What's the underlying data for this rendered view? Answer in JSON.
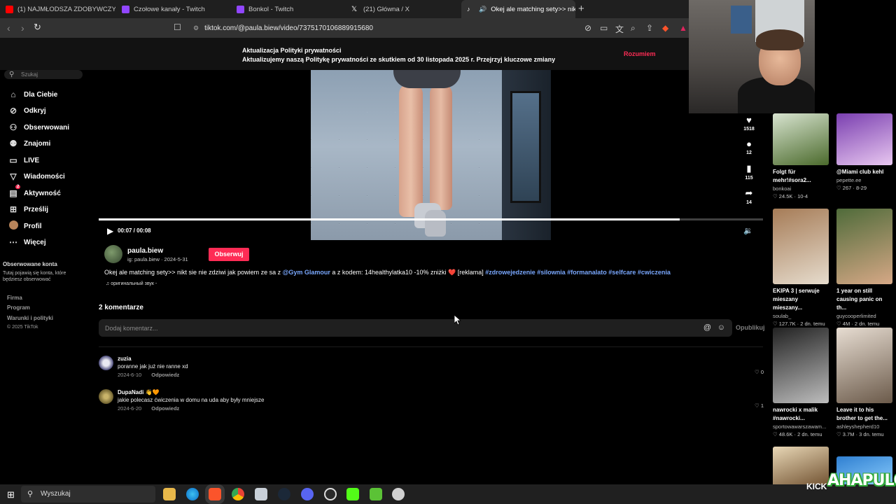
{
  "browser": {
    "tabs": [
      {
        "label": "(1) NAJMŁODSZA ZDOBYWCZYNI M",
        "favicon_color": "#ff0000"
      },
      {
        "label": "Czołowe kanały - Twitch",
        "favicon_color": "#9146ff"
      },
      {
        "label": "Bonkol - Twitch",
        "favicon_color": "#9146ff"
      },
      {
        "label": "(21) Główna / X",
        "favicon_color": "#ffffff"
      },
      {
        "label": "Okej ale matching sety>> nik",
        "favicon_color": "#ffffff"
      }
    ],
    "url": "tiktok.com/@paula.biew/video/7375170106889915680"
  },
  "banner": {
    "title": "Aktualizacja Polityki prywatności",
    "text": "Aktualizujemy naszą Politykę prywatności ze skutkiem od 30 listopada 2025 r. Przejrzyj kluczowe zmiany",
    "button": "Rozumiem"
  },
  "sidebar": {
    "search_placeholder": "Szukaj",
    "items": [
      {
        "label": "Dla Ciebie",
        "icon": "home-icon"
      },
      {
        "label": "Odkryj",
        "icon": "compass-icon"
      },
      {
        "label": "Obserwowani",
        "icon": "following-icon"
      },
      {
        "label": "Znajomi",
        "icon": "friends-icon"
      },
      {
        "label": "LIVE",
        "icon": "live-icon"
      },
      {
        "label": "Wiadomości",
        "icon": "send-icon"
      },
      {
        "label": "Aktywność",
        "icon": "activity-icon",
        "badge": "2"
      },
      {
        "label": "Prześlij",
        "icon": "upload-icon"
      },
      {
        "label": "Profil",
        "icon": "avatar"
      },
      {
        "label": "Więcej",
        "icon": "more-icon"
      }
    ],
    "followed_heading": "Obserwowane konta",
    "followed_note": "Tutaj pojawią się konta, które będziesz obserwować",
    "footer": [
      "Firma",
      "Program",
      "Warunki i polityki",
      "© 2025 TikTok"
    ]
  },
  "video": {
    "time": "00:07 / 00:08",
    "progress": 0.875,
    "likes": "1518",
    "comments": "12",
    "saves": "115",
    "shares": "14"
  },
  "author": {
    "name": "paula.biew",
    "sub": "ig: paula.biew · 2024-5-31",
    "follow_label": "Obserwuj"
  },
  "description": {
    "text_a": "Okej ale matching sety>> nikt sie nie zdziwi jak powiem ze sa z ",
    "mention": "@Gym Glamour",
    "text_b": " a z kodem: 14healthylatka10 -10% zniżki ",
    "heart": "❤️",
    "text_c": " [reklama] ",
    "hashtags": "#zdrowejedzenie #silownia #formanalato #selfcare #cwiczenia",
    "sound": "оригинальный звук -"
  },
  "comments": {
    "title": "2 komentarze",
    "placeholder": "Dodaj komentarz...",
    "post_label": "Opublikuj",
    "items": [
      {
        "user": "zuzia",
        "text": "poranne jak już nie ranne xd",
        "date": "2024-6-10",
        "reply": "Odpowiedz",
        "likes": "0",
        "avatar_color": "#c9c9d8"
      },
      {
        "user": "DupaNadi 👋🧡",
        "text": "jakie polecasz ćwiczenia w domu na uda aby były mniejsze",
        "date": "2024-6-20",
        "reply": "Odpowiedz",
        "likes": "1",
        "avatar_color": "#8a7a3a"
      }
    ]
  },
  "recommended": [
    {
      "title": "Folgt für mehr!#sora2...",
      "channel": "bonkoai",
      "stats": "♡ 24.5K · 10-4",
      "colors": [
        "#d8e4d0",
        "#4b6a2c"
      ]
    },
    {
      "title": "@Miami club kehl",
      "channel": "pepette.ee",
      "stats": "♡ 267 · 8-29",
      "colors": [
        "#7a3fb0",
        "#e8c7f0"
      ]
    },
    {
      "title": "EKIPA 3 | serwuje mieszany mieszany...",
      "channel": "soulab_",
      "stats": "♡ 127.7K · 2 dn. temu",
      "colors": [
        "#a67c57",
        "#e6dccd"
      ]
    },
    {
      "title": "1 year on still causing panic on th...",
      "channel": "guycooperlimited",
      "stats": "♡ 4M · 2 dn. temu",
      "colors": [
        "#4f6b3a",
        "#d6a886"
      ]
    },
    {
      "title": "nawrocki x malik #nawrocki...",
      "channel": "sportowawarszawam...",
      "stats": "♡ 48.6K · 2 dn. temu",
      "colors": [
        "#222222",
        "#bdbdbd"
      ]
    },
    {
      "title": "Leave it to his brother to get the...",
      "channel": "ashleyshepherd10",
      "stats": "♡ 3.7M · 3 dn. temu",
      "colors": [
        "#e7ddd2",
        "#6b5a4a"
      ]
    },
    {
      "title": "",
      "channel": "",
      "stats": "",
      "colors": [
        "#e8d7b6",
        "#6b4b2a"
      ]
    },
    {
      "title": "",
      "channel": "",
      "stats": "",
      "colors": [
        "#2f7fd1",
        "#8fd1ff"
      ]
    }
  ],
  "taskbar": {
    "search_label": "Wyszukaj",
    "apps": [
      "file-explorer-icon",
      "edge-icon",
      "brave-icon",
      "chrome-icon",
      "app-icon",
      "steam-icon",
      "discord-icon",
      "obs-icon",
      "media-icon",
      "game-icon",
      "shield-app-icon"
    ]
  },
  "overlay": {
    "kick": "KICK",
    "brand": "AHAPULCO"
  }
}
